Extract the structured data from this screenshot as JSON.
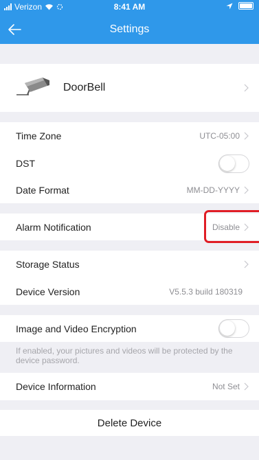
{
  "status_bar": {
    "carrier": "Verizon",
    "time": "8:41 AM"
  },
  "nav": {
    "title": "Settings",
    "back_icon": "back-arrow-icon"
  },
  "device": {
    "name": "DoorBell",
    "icon": "security-camera-icon"
  },
  "settings": {
    "time_zone": {
      "label": "Time Zone",
      "value": "UTC-05:00"
    },
    "dst": {
      "label": "DST",
      "enabled": false
    },
    "date_format": {
      "label": "Date Format",
      "value": "MM-DD-YYYY"
    },
    "alarm_notification": {
      "label": "Alarm Notification",
      "value": "Disable"
    },
    "storage_status": {
      "label": "Storage Status"
    },
    "device_version": {
      "label": "Device Version",
      "value": "V5.5.3 build 180319"
    },
    "encryption": {
      "label": "Image and Video Encryption",
      "enabled": false,
      "hint": "If enabled, your pictures and videos will be protected by the device password."
    },
    "device_information": {
      "label": "Device Information",
      "value": "Not Set"
    }
  },
  "actions": {
    "delete_label": "Delete Device"
  },
  "colors": {
    "nav_blue": "#2f98ea",
    "highlight_red": "#e01d25",
    "background": "#efeff4"
  }
}
